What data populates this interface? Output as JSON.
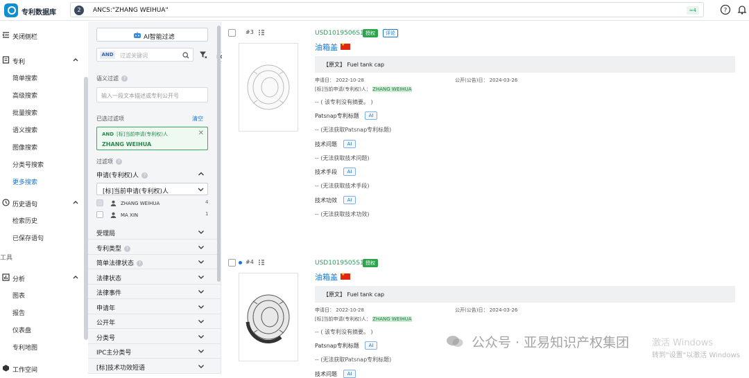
{
  "app": {
    "name": "专利数据库"
  },
  "search": {
    "badge": "2",
    "query": "ANCS:\"ZHANG WEIHUA\"",
    "count_label": "≈4"
  },
  "sidebar": {
    "collapse_label": "关闭侧栏",
    "patent_section": "专利",
    "patent_items": [
      "简单搜索",
      "高级搜索",
      "批量搜索",
      "语义搜索",
      "图像搜索",
      "分类号搜索",
      "更多搜索"
    ],
    "history_section": "历史语句",
    "history_items": [
      "检索历史",
      "已保存语句"
    ],
    "tools_section": "工具",
    "analysis_section": "分析",
    "analysis_items": [
      "图表",
      "报告",
      "仪表盘",
      "专利地图"
    ],
    "workspace_section": "工作空间"
  },
  "filter": {
    "ai_button": "AI智能过滤",
    "kw_and": "AND",
    "kw_placeholder": "过滤关键词",
    "semantic_label": "语义过滤",
    "semantic_placeholder": "输入一段文本描述或专利公开号",
    "selected_label": "已选过滤项",
    "clear_label": "清空",
    "chip_and": "AND",
    "chip_field": "[标]当前申请(专利权)人",
    "chip_value": "ZHANG WEIHUA",
    "filters_label": "过滤项",
    "applicant_section": "申请(专利权)人",
    "applicant_dropdown": "[标]当前申请(专利权)人",
    "applicants": [
      {
        "name": "ZHANG WEIHUA",
        "count": "4",
        "checked": true
      },
      {
        "name": "MA XIN",
        "count": "1",
        "checked": false
      }
    ],
    "sections": [
      "受理局",
      "专利类型",
      "简单法律状态",
      "法律状态",
      "法律事件",
      "申请年",
      "公开年",
      "分类号",
      "IPC主分类号",
      "[标]技术功效短语"
    ]
  },
  "results": [
    {
      "index": "#3",
      "pub_no": "USD1019506S1",
      "tags": [
        "授权",
        "评论"
      ],
      "title": "油箱盖",
      "original": "【原文】 Fuel tank cap",
      "apply_date_label": "申请日：",
      "apply_date": "2022-10-28",
      "pub_date_label": "公开(公告)日：",
      "pub_date": "2024-03-26",
      "applicant_label": "[标]当前申请(专利权)人：",
      "applicant": "ZHANG WEIHUA",
      "abstract": "-- ( 该专利没有摘要。 )",
      "ai_fields": [
        {
          "label": "Patsnap专利标题",
          "value": "-- (无法获取Patsnap专利标题)"
        },
        {
          "label": "技术问题",
          "value": "-- (无法获取技术问题)"
        },
        {
          "label": "技术手段",
          "value": "-- (无法获取技术手段)"
        },
        {
          "label": "技术功效",
          "value": "-- (无法获取技术功效)"
        }
      ]
    },
    {
      "index": "#4",
      "pub_no": "USD1019505S1",
      "tags": [
        "授权"
      ],
      "title": "油箱盖",
      "original": "【原文】 Fuel tank cap",
      "apply_date_label": "申请日：",
      "apply_date": "2022-10-28",
      "pub_date_label": "公开(公告)日：",
      "pub_date": "2024-03-26",
      "applicant_label": "[标]当前申请(专利权)人：",
      "applicant": "ZHANG WEIHUA",
      "abstract": "-- ( 该专利没有摘要。 )",
      "ai_fields": [
        {
          "label": "Patsnap专利标题",
          "value": "-- (无法获取Patsnap专利标题)"
        },
        {
          "label": "技术问题",
          "value": ""
        }
      ]
    }
  ],
  "ai_tag": "AI",
  "overlay": {
    "watermark": "公众号 · 亚易知识产权集团",
    "windows_line1": "激活 Windows",
    "windows_line2": "转到\"设置\"以激活 Windows"
  },
  "colors": {
    "brand": "#0f8fd1",
    "link": "#1677d2",
    "green": "#2da44e"
  }
}
